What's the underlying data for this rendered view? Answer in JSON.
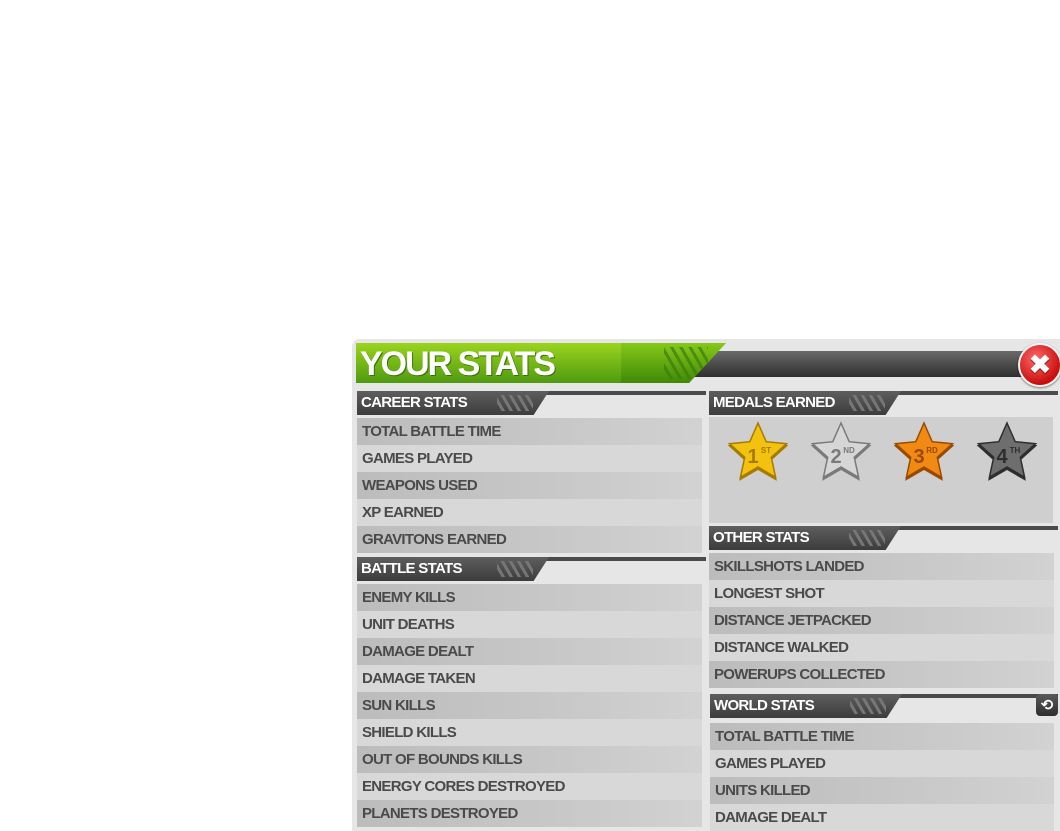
{
  "title": "YOUR STATS",
  "close_icon": "close-icon",
  "career": {
    "title": "CAREER STATS",
    "items": [
      "TOTAL BATTLE TIME",
      "GAMES PLAYED",
      "WEAPONS USED",
      "XP EARNED",
      "GRAVITONS EARNED"
    ]
  },
  "battle": {
    "title": "BATTLE STATS",
    "items": [
      "ENEMY KILLS",
      "UNIT DEATHS",
      "DAMAGE DEALT",
      "DAMAGE TAKEN",
      "SUN KILLS",
      "SHIELD KILLS",
      "OUT OF BOUNDS KILLS",
      "ENERGY CORES DESTROYED",
      "PLANETS DESTROYED"
    ]
  },
  "medals": {
    "title": "MEDALS EARNED",
    "items": [
      {
        "label": "1",
        "sup": "ST",
        "color": "#f2c20f",
        "dark": "#a67b00"
      },
      {
        "label": "2",
        "sup": "ND",
        "color": "#d6d6d6",
        "dark": "#7a7a7a"
      },
      {
        "label": "3",
        "sup": "RD",
        "color": "#f08a12",
        "dark": "#9a4a00"
      },
      {
        "label": "4",
        "sup": "TH",
        "color": "#6e6e6e",
        "dark": "#2e2e2e"
      }
    ]
  },
  "other": {
    "title": "OTHER STATS",
    "items": [
      "SKILLSHOTS LANDED",
      "LONGEST SHOT",
      "DISTANCE JETPACKED",
      "DISTANCE WALKED",
      "POWERUPS COLLECTED"
    ]
  },
  "world": {
    "title": "WORLD STATS",
    "refresh_icon": "refresh-icon",
    "items": [
      "TOTAL BATTLE TIME",
      "GAMES PLAYED",
      "UNITS KILLED",
      "DAMAGE DEALT"
    ]
  },
  "colors": {
    "title_green": "#7cc414",
    "header_dark": "#444444",
    "close_red": "#d41414"
  }
}
